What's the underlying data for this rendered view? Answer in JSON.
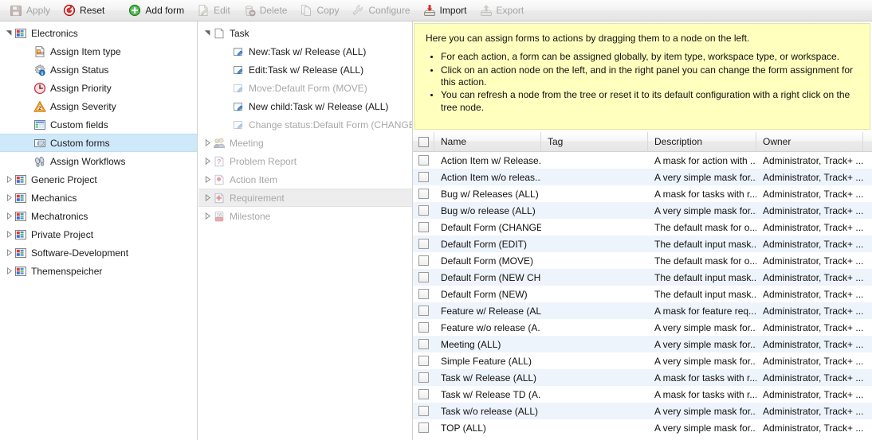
{
  "toolbar": {
    "buttons": [
      {
        "label": "Apply",
        "icon": "save-icon",
        "disabled": true,
        "sep_after": false
      },
      {
        "label": "Reset",
        "icon": "reset-icon",
        "disabled": false,
        "sep_after": true
      },
      {
        "label": "Add form",
        "icon": "add-icon",
        "disabled": false,
        "sep_after": false
      },
      {
        "label": "Edit",
        "icon": "edit-icon",
        "disabled": true,
        "sep_after": false
      },
      {
        "label": "Delete",
        "icon": "delete-icon",
        "disabled": true,
        "sep_after": false
      },
      {
        "label": "Copy",
        "icon": "copy-icon",
        "disabled": true,
        "sep_after": false
      },
      {
        "label": "Configure",
        "icon": "configure-icon",
        "disabled": true,
        "sep_after": false
      },
      {
        "label": "Import",
        "icon": "import-icon",
        "disabled": false,
        "sep_after": false
      },
      {
        "label": "Export",
        "icon": "export-icon",
        "disabled": true,
        "sep_after": false
      }
    ]
  },
  "left_tree": {
    "items": [
      {
        "label": "Electronics",
        "icon": "workspace-icon",
        "indent": 0,
        "expander": "expanded",
        "selected": false,
        "dim": false
      },
      {
        "label": "Assign Item type",
        "icon": "assign-item-type-icon",
        "indent": 1,
        "expander": "none",
        "selected": false,
        "dim": false
      },
      {
        "label": "Assign Status",
        "icon": "assign-status-icon",
        "indent": 1,
        "expander": "none",
        "selected": false,
        "dim": false
      },
      {
        "label": "Assign Priority",
        "icon": "assign-priority-icon",
        "indent": 1,
        "expander": "none",
        "selected": false,
        "dim": false
      },
      {
        "label": "Assign Severity",
        "icon": "assign-severity-icon",
        "indent": 1,
        "expander": "none",
        "selected": false,
        "dim": false
      },
      {
        "label": "Custom fields",
        "icon": "custom-fields-icon",
        "indent": 1,
        "expander": "none",
        "selected": false,
        "dim": false
      },
      {
        "label": "Custom forms",
        "icon": "custom-forms-icon",
        "indent": 1,
        "expander": "none",
        "selected": true,
        "dim": false
      },
      {
        "label": "Assign Workflows",
        "icon": "assign-workflows-icon",
        "indent": 1,
        "expander": "none",
        "selected": false,
        "dim": false
      },
      {
        "label": "Generic Project",
        "icon": "workspace-icon",
        "indent": 0,
        "expander": "collapsed",
        "selected": false,
        "dim": false
      },
      {
        "label": "Mechanics",
        "icon": "workspace-icon",
        "indent": 0,
        "expander": "collapsed",
        "selected": false,
        "dim": false
      },
      {
        "label": "Mechatronics",
        "icon": "workspace-icon",
        "indent": 0,
        "expander": "collapsed",
        "selected": false,
        "dim": false
      },
      {
        "label": "Private Project",
        "icon": "workspace-icon",
        "indent": 0,
        "expander": "collapsed",
        "selected": false,
        "dim": false
      },
      {
        "label": "Software-Development",
        "icon": "workspace-icon",
        "indent": 0,
        "expander": "collapsed",
        "selected": false,
        "dim": false
      },
      {
        "label": "Themenspeicher",
        "icon": "workspace-icon",
        "indent": 0,
        "expander": "collapsed",
        "selected": false,
        "dim": false
      }
    ]
  },
  "mid_tree": {
    "items": [
      {
        "label": "Task",
        "icon": "task-icon",
        "indent": 0,
        "expander": "expanded",
        "dim": false,
        "hover": false
      },
      {
        "label": "New:Task w/ Release (ALL)",
        "icon": "form-icon",
        "indent": 1,
        "expander": "none",
        "dim": false,
        "hover": false
      },
      {
        "label": "Edit:Task w/ Release (ALL)",
        "icon": "form-icon",
        "indent": 1,
        "expander": "none",
        "dim": false,
        "hover": false
      },
      {
        "label": "Move:Default Form (MOVE)",
        "icon": "form-icon",
        "indent": 1,
        "expander": "none",
        "dim": true,
        "hover": false
      },
      {
        "label": "New child:Task w/ Release (ALL)",
        "icon": "form-icon",
        "indent": 1,
        "expander": "none",
        "dim": false,
        "hover": false
      },
      {
        "label": "Change status:Default Form (CHANGE STATUS)",
        "icon": "form-icon",
        "indent": 1,
        "expander": "none",
        "dim": true,
        "hover": false
      },
      {
        "label": "Meeting",
        "icon": "meeting-icon",
        "indent": 0,
        "expander": "collapsed",
        "dim": true,
        "hover": false
      },
      {
        "label": "Problem Report",
        "icon": "problem-report-icon",
        "indent": 0,
        "expander": "collapsed",
        "dim": true,
        "hover": false
      },
      {
        "label": "Action Item",
        "icon": "action-item-icon",
        "indent": 0,
        "expander": "collapsed",
        "dim": true,
        "hover": false
      },
      {
        "label": "Requirement",
        "icon": "requirement-icon",
        "indent": 0,
        "expander": "collapsed",
        "dim": true,
        "hover": true
      },
      {
        "label": "Milestone",
        "icon": "milestone-icon",
        "indent": 0,
        "expander": "collapsed",
        "dim": true,
        "hover": false
      }
    ]
  },
  "info": {
    "intro": "Here you can assign forms to actions by dragging them to a node on the left.",
    "bullets": [
      "For each action, a form can be assigned globally, by item type, workspace type, or workspace.",
      "Click on an action node on the left, and in the right panel you can change the form assignment for this action.",
      "You can refresh a node from the tree or reset it to its default configuration with a right click on the tree node."
    ]
  },
  "table": {
    "columns": [
      {
        "key": "name",
        "label": "Name"
      },
      {
        "key": "tag",
        "label": "Tag"
      },
      {
        "key": "desc",
        "label": "Description"
      },
      {
        "key": "own",
        "label": "Owner"
      }
    ],
    "rows": [
      {
        "name": "Action Item w/ Release...",
        "tag": "",
        "desc": "A mask for action with ...",
        "own": "Administrator, Track+ ..."
      },
      {
        "name": "Action Item w/o releas...",
        "tag": "",
        "desc": "A very simple mask for...",
        "own": "Administrator, Track+ ..."
      },
      {
        "name": "Bug w/ Releases (ALL)",
        "tag": "",
        "desc": "A mask for tasks with r...",
        "own": "Administrator, Track+ ..."
      },
      {
        "name": "Bug w/o release (ALL)",
        "tag": "",
        "desc": "A very simple mask for...",
        "own": "Administrator, Track+ ..."
      },
      {
        "name": "Default Form (CHANGE...",
        "tag": "",
        "desc": "The default mask for o...",
        "own": "Administrator, Track+ ..."
      },
      {
        "name": "Default Form (EDIT)",
        "tag": "",
        "desc": "The default input mask...",
        "own": "Administrator, Track+ ..."
      },
      {
        "name": "Default Form (MOVE)",
        "tag": "",
        "desc": "The default mask for o...",
        "own": "Administrator, Track+ ..."
      },
      {
        "name": "Default Form (NEW CH...",
        "tag": "",
        "desc": "The default input mask...",
        "own": "Administrator, Track+ ..."
      },
      {
        "name": "Default Form (NEW)",
        "tag": "",
        "desc": "The default input mask...",
        "own": "Administrator, Track+ ..."
      },
      {
        "name": "Feature w/ Release (ALL)",
        "tag": "",
        "desc": "A mask for feature req...",
        "own": "Administrator, Track+ ..."
      },
      {
        "name": "Feature w/o release (A...",
        "tag": "",
        "desc": "A very simple mask for...",
        "own": "Administrator, Track+ ..."
      },
      {
        "name": "Meeting (ALL)",
        "tag": "",
        "desc": "A very simple mask for...",
        "own": "Administrator, Track+ ..."
      },
      {
        "name": "Simple Feature (ALL)",
        "tag": "",
        "desc": "A very simple mask for...",
        "own": "Administrator, Track+ ..."
      },
      {
        "name": "Task w/ Release (ALL)",
        "tag": "",
        "desc": "A mask for tasks with r...",
        "own": "Administrator, Track+ ..."
      },
      {
        "name": "Task w/ Release TD (A...",
        "tag": "",
        "desc": "A mask for tasks with r...",
        "own": "Administrator, Track+ ..."
      },
      {
        "name": "Task w/o release (ALL)",
        "tag": "",
        "desc": "A very simple mask for...",
        "own": "Administrator, Track+ ..."
      },
      {
        "name": "TOP (ALL)",
        "tag": "",
        "desc": "A very simple mask for...",
        "own": "Administrator, Track+ ..."
      }
    ]
  },
  "colors": {
    "selection": "#cfe8fa",
    "hover": "#ededed",
    "info_bg": "#ffffbe",
    "row_alt": "#eef4fb",
    "accent_red": "#cc2222",
    "accent_green": "#3a9a3a"
  }
}
